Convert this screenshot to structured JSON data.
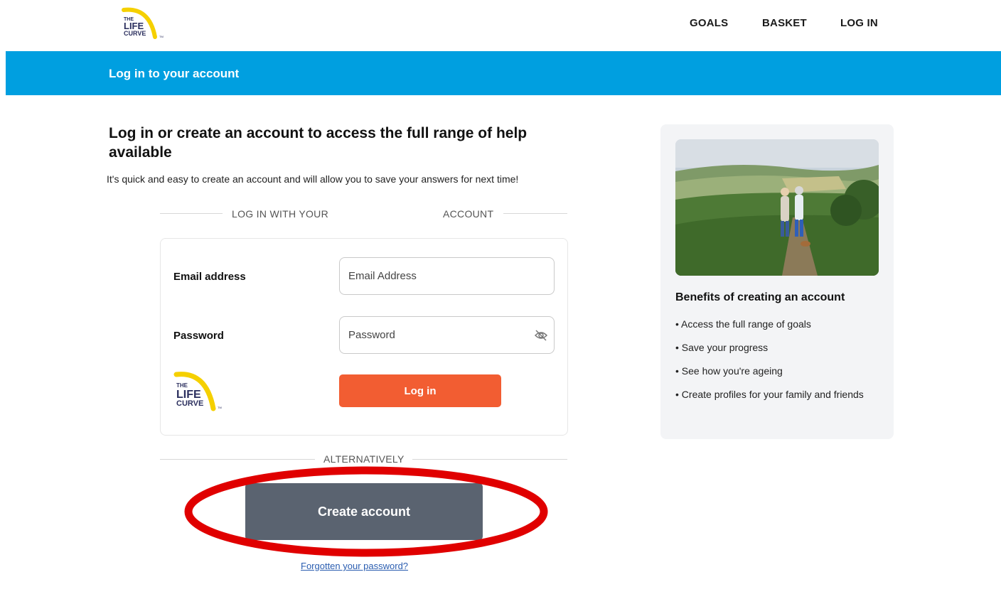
{
  "header": {
    "logo_alt": "THE LIFE CURVE",
    "nav": [
      "GOALS",
      "BASKET",
      "LOG IN"
    ]
  },
  "banner": {
    "title": "Log in to your account"
  },
  "main": {
    "heading": "Log in or create an account to access the full range of help available",
    "subtext": "It's quick and easy to create an account and will allow you to save your answers for next time!",
    "divider_left": "LOG IN WITH YOUR",
    "divider_right": "ACCOUNT",
    "email_label": "Email address",
    "email_placeholder": "Email Address",
    "password_label": "Password",
    "password_placeholder": "Password",
    "login_button": "Log in",
    "alternatively": "ALTERNATIVELY",
    "create_button": "Create  account",
    "forgot_link": "Forgotten your password?"
  },
  "sidebar": {
    "title": "Benefits of creating an account",
    "items": [
      "• Access the full range of goals",
      "• Save your progress",
      "• See how you're ageing",
      "• Create profiles for your family and friends"
    ]
  },
  "colors": {
    "banner": "#009fe0",
    "login_button": "#f25d32",
    "create_button": "#5a6370",
    "highlight": "#e00000",
    "logo_yellow": "#f5d000",
    "logo_navy": "#2b2f5e"
  }
}
